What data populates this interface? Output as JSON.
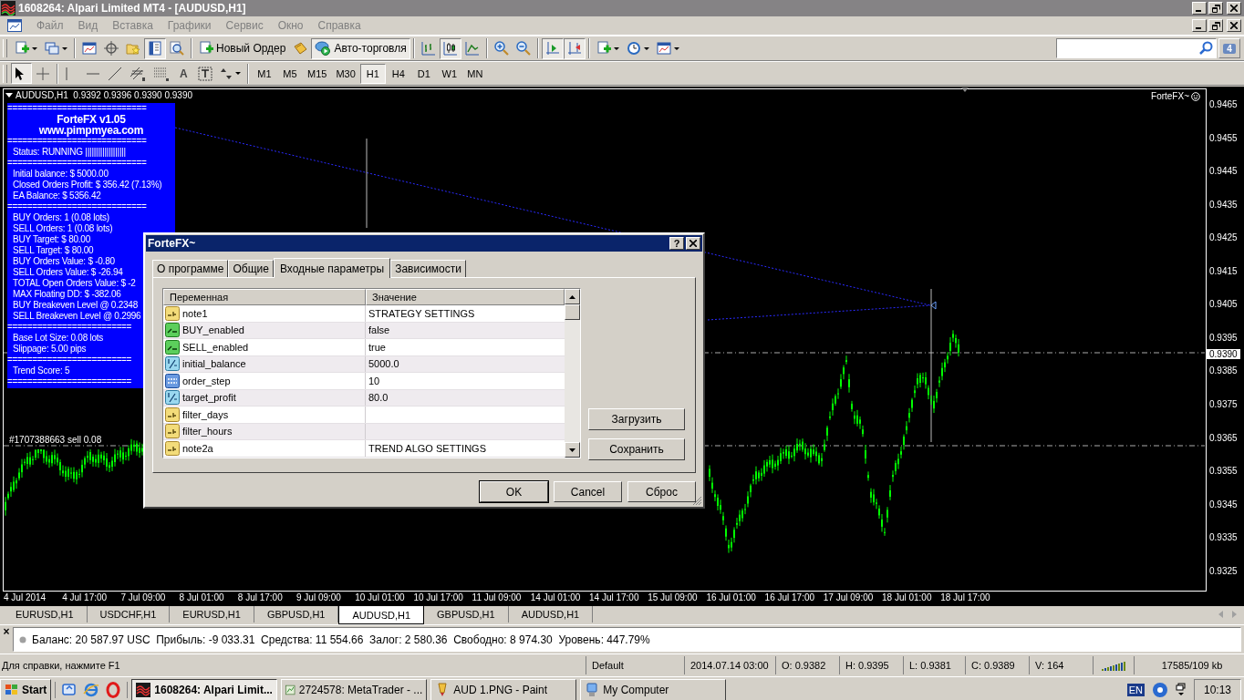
{
  "window": {
    "title": "1608264: Alpari Limited MT4 - [AUDUSD,H1]"
  },
  "menu": [
    "Файл",
    "Вид",
    "Вставка",
    "Графики",
    "Сервис",
    "Окно",
    "Справка"
  ],
  "toolbar": [
    {
      "pressed": false
    },
    {
      "pressed": false
    },
    {
      "pressed": false
    },
    {
      "pressed": false
    },
    {
      "pressed": false
    },
    {
      "pressed": true
    },
    {
      "pressed": false
    },
    {
      "label": "Новый Ордер",
      "pressed": false
    },
    {
      "pressed": false
    },
    {
      "label": "Авто-торговля",
      "pressed": true
    },
    {
      "pressed": false
    },
    {
      "pressed": true
    },
    {
      "pressed": false
    },
    {
      "pressed": false
    },
    {
      "pressed": false
    },
    {
      "pressed": true
    },
    {
      "pressed": true
    },
    {
      "pressed": false
    },
    {
      "pressed": false
    },
    {
      "pressed": false
    }
  ],
  "search": {
    "badge": "4"
  },
  "drawing_tools": [
    {
      "pressed": true
    },
    {
      "pressed": false
    },
    {
      "pressed": false
    },
    {
      "pressed": false
    },
    {
      "pressed": false
    },
    {
      "pressed": false
    },
    {
      "pressed": false
    },
    {
      "label": "A",
      "pressed": false
    },
    {
      "pressed": false
    },
    {
      "pressed": false
    }
  ],
  "timeframes": [
    {
      "label": "M1",
      "selected": false
    },
    {
      "label": "M5",
      "selected": false
    },
    {
      "label": "M15",
      "selected": false
    },
    {
      "label": "M30",
      "selected": false
    },
    {
      "label": "H1",
      "selected": true
    },
    {
      "label": "H4",
      "selected": false
    },
    {
      "label": "D1",
      "selected": false
    },
    {
      "label": "W1",
      "selected": false
    },
    {
      "label": "MN",
      "selected": false
    }
  ],
  "chart": {
    "header": "AUDUSD,H1  0.9392 0.9396 0.9390 0.9390",
    "expert": "ForteFX~",
    "order_label": "#1707388663 sell 0.08",
    "current_price": "0.9390",
    "price_axis": [
      "0.9465",
      "0.9455",
      "0.9445",
      "0.9435",
      "0.9425",
      "0.9415",
      "0.9405",
      "0.9395",
      "0.9385",
      "0.9375",
      "0.9365",
      "0.9355",
      "0.9345",
      "0.9335",
      "0.9325"
    ],
    "time_axis": [
      "4 Jul 2014",
      "4 Jul 17:00",
      "7 Jul 09:00",
      "8 Jul 01:00",
      "8 Jul 17:00",
      "9 Jul 09:00",
      "10 Jul 01:00",
      "10 Jul 17:00",
      "11 Jul 09:00",
      "14 Jul 01:00",
      "14 Jul 17:00",
      "15 Jul 09:00",
      "16 Jul 01:00",
      "16 Jul 17:00",
      "17 Jul 09:00",
      "18 Jul 01:00",
      "18 Jul 17:00"
    ],
    "info_panel": [
      {
        "kind": "rule",
        "text": "============================"
      },
      {
        "kind": "title",
        "text": "ForteFX v1.05"
      },
      {
        "kind": "title",
        "text": "www.pimpmyea.com"
      },
      {
        "kind": "rule",
        "text": "============================"
      },
      {
        "kind": "text",
        "text": "Status: RUNNING |||||||||||||||||||"
      },
      {
        "kind": "rule",
        "text": "============================"
      },
      {
        "kind": "text",
        "text": "Initial balance: $ 5000.00"
      },
      {
        "kind": "text",
        "text": "Closed Orders Profit: $ 356.42 (7.13%)"
      },
      {
        "kind": "text",
        "text": "EA Balance: $ 5356.42"
      },
      {
        "kind": "rule",
        "text": "============================"
      },
      {
        "kind": "text",
        "text": "BUY Orders: 1 (0.08 lots)"
      },
      {
        "kind": "text",
        "text": "SELL Orders: 1 (0.08 lots)"
      },
      {
        "kind": "text",
        "text": "BUY Target: $ 80.00"
      },
      {
        "kind": "text",
        "text": "SELL Target: $ 80.00"
      },
      {
        "kind": "text",
        "text": "BUY Orders Value: $ -0.80"
      },
      {
        "kind": "text",
        "text": "SELL Orders Value: $ -26.94"
      },
      {
        "kind": "text",
        "text": "TOTAL Open Orders Value: $ -2"
      },
      {
        "kind": "text",
        "text": "MAX Floating DD: $ -382.06"
      },
      {
        "kind": "text",
        "text": "BUY Breakeven Level @ 0.2348"
      },
      {
        "kind": "text",
        "text": "SELL Breakeven Level @ 0.2996"
      },
      {
        "kind": "rule",
        "text": "========================="
      },
      {
        "kind": "text",
        "text": "Base Lot Size: 0.08 lots"
      },
      {
        "kind": "text",
        "text": "Slippage: 5.00 pips"
      },
      {
        "kind": "rule",
        "text": "========================="
      },
      {
        "kind": "text",
        "text": "Trend Score: 5"
      },
      {
        "kind": "rule",
        "text": "========================="
      }
    ]
  },
  "dialog": {
    "title": "ForteFX~",
    "help": "?",
    "tabs": [
      {
        "label": "О программе",
        "selected": false
      },
      {
        "label": "Общие",
        "selected": false
      },
      {
        "label": "Входные параметры",
        "selected": true
      },
      {
        "label": "Зависимости",
        "selected": false
      }
    ],
    "columns": [
      "Переменная",
      "Значение"
    ],
    "rows": [
      {
        "kind": "string",
        "name": "note1",
        "value": "STRATEGY SETTINGS"
      },
      {
        "kind": "bool",
        "name": "BUY_enabled",
        "value": "false"
      },
      {
        "kind": "bool",
        "name": "SELL_enabled",
        "value": "true"
      },
      {
        "kind": "double",
        "name": "initial_balance",
        "value": "5000.0"
      },
      {
        "kind": "int",
        "name": "order_step",
        "value": "10"
      },
      {
        "kind": "double",
        "name": "target_profit",
        "value": "80.0"
      },
      {
        "kind": "string",
        "name": "filter_days"
      },
      {
        "kind": "string",
        "name": "filter_hours"
      },
      {
        "kind": "string",
        "name": "note2a",
        "value": "TREND ALGO SETTINGS"
      }
    ],
    "side_buttons": [
      "Загрузить",
      "Сохранить"
    ],
    "buttons": [
      "OK",
      "Cancel",
      "Сброс"
    ]
  },
  "symbol_tabs": [
    {
      "label": "EURUSD,H1",
      "selected": false
    },
    {
      "label": "USDCHF,H1",
      "selected": false
    },
    {
      "label": "EURUSD,H1",
      "selected": false
    },
    {
      "label": "GBPUSD,H1",
      "selected": false
    },
    {
      "label": "AUDUSD,H1",
      "selected": true
    },
    {
      "label": "GBPUSD,H1",
      "selected": false
    },
    {
      "label": "AUDUSD,H1",
      "selected": false
    }
  ],
  "terminal": {
    "close": "×",
    "summary": "Баланс: 20 587.97 USC  Прибыль: -9 033.31  Средства: 11 554.66  Залог: 2 580.36  Свободно: 8 974.30  Уровень: 447.79%"
  },
  "status_bar": {
    "help": "Для справки, нажмите F1",
    "fields": [
      "Default",
      "2014.07.14 03:00",
      "O: 0.9382",
      "H: 0.9395",
      "L: 0.9381",
      "C: 0.9389",
      "V: 164"
    ],
    "traffic": "17585/109 kb"
  },
  "taskbar": {
    "start": "Start",
    "tasks": [
      {
        "label": "1608264: Alpari Limit...",
        "selected": true
      },
      {
        "label": "2724578: MetaTrader - ...",
        "selected": false
      },
      {
        "label": "AUD 1.PNG - Paint",
        "selected": false
      },
      {
        "label": "My Computer",
        "selected": false
      }
    ],
    "language": "EN",
    "clock": "10:13"
  }
}
